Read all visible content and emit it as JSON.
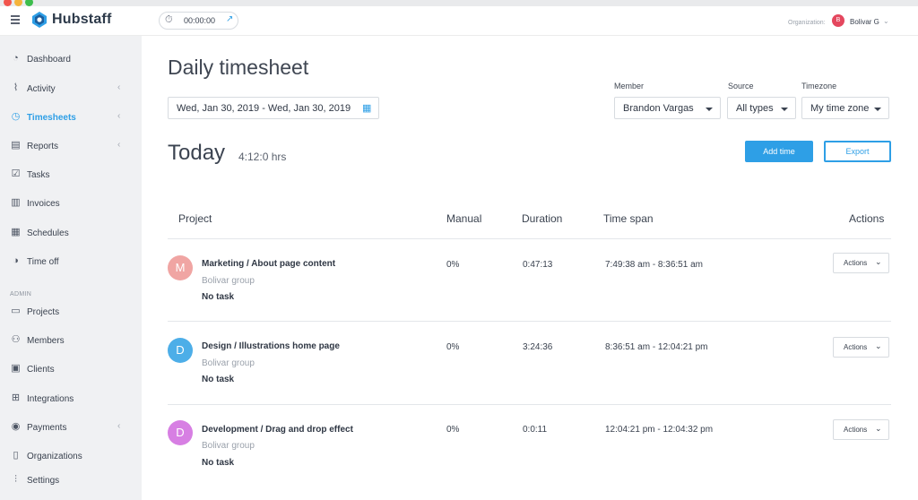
{
  "app": {
    "name": "Hubstaff"
  },
  "timer": {
    "value": "00:00:00"
  },
  "org": {
    "label": "Organization:",
    "avatar_letter": "B",
    "name": "Bolivar G"
  },
  "sidebar": {
    "items": [
      {
        "label": "Dashboard",
        "icon": "dashboard-icon"
      },
      {
        "label": "Activity",
        "icon": "activity-icon",
        "has_chevron": true
      },
      {
        "label": "Timesheets",
        "icon": "clock-icon",
        "has_chevron": true,
        "active": true
      },
      {
        "label": "Reports",
        "icon": "reports-icon",
        "has_chevron": true
      },
      {
        "label": "Tasks",
        "icon": "tasks-icon"
      },
      {
        "label": "Invoices",
        "icon": "invoices-icon"
      },
      {
        "label": "Schedules",
        "icon": "calendar-icon"
      },
      {
        "label": "Time off",
        "icon": "time-off-icon"
      }
    ],
    "admin_label": "ADMIN",
    "admin_items": [
      {
        "label": "Projects",
        "icon": "folder-icon"
      },
      {
        "label": "Members",
        "icon": "members-icon"
      },
      {
        "label": "Clients",
        "icon": "clients-icon"
      },
      {
        "label": "Integrations",
        "icon": "integrations-icon"
      },
      {
        "label": "Payments",
        "icon": "payments-icon",
        "has_chevron": true
      },
      {
        "label": "Organizations",
        "icon": "organizations-icon"
      },
      {
        "label": "Settings",
        "icon": "settings-icon"
      }
    ]
  },
  "main": {
    "title": "Daily timesheet",
    "date_range": "Wed, Jan 30, 2019 - Wed, Jan 30, 2019",
    "filters": {
      "member": {
        "label": "Member",
        "value": "Brandon Vargas"
      },
      "source": {
        "label": "Source",
        "value": "All types"
      },
      "timezone": {
        "label": "Timezone",
        "value": "My time zone"
      }
    },
    "today_label": "Today",
    "today_hours": "4:12:0 hrs",
    "add_time_label": "Add time",
    "export_label": "Export",
    "columns": [
      "Project",
      "Manual",
      "Duration",
      "Time span",
      "Actions"
    ],
    "rows": [
      {
        "avatar": "M",
        "avatar_color": "#f0a5a3",
        "project": "Marketing / About page content",
        "group": "Bolivar group",
        "task": "No task",
        "manual": "0%",
        "duration": "0:47:13",
        "span": "7:49:38 am - 8:36:51 am",
        "action": "Actions"
      },
      {
        "avatar": "D",
        "avatar_color": "#4daee8",
        "project": "Design / Illustrations home page",
        "group": "Bolivar group",
        "task": "No task",
        "manual": "0%",
        "duration": "3:24:36",
        "span": "8:36:51 am - 12:04:21 pm",
        "action": "Actions"
      },
      {
        "avatar": "D",
        "avatar_color": "#d77fe3",
        "project": "Development / Drag and drop effect",
        "group": "Bolivar group",
        "task": "No task",
        "manual": "0%",
        "duration": "0:0:11",
        "span": "12:04:21 pm - 12:04:32 pm",
        "action": "Actions"
      }
    ]
  },
  "colors": {
    "accent": "#2e9fe6",
    "sidebar_bg": "#f0f1f3"
  }
}
